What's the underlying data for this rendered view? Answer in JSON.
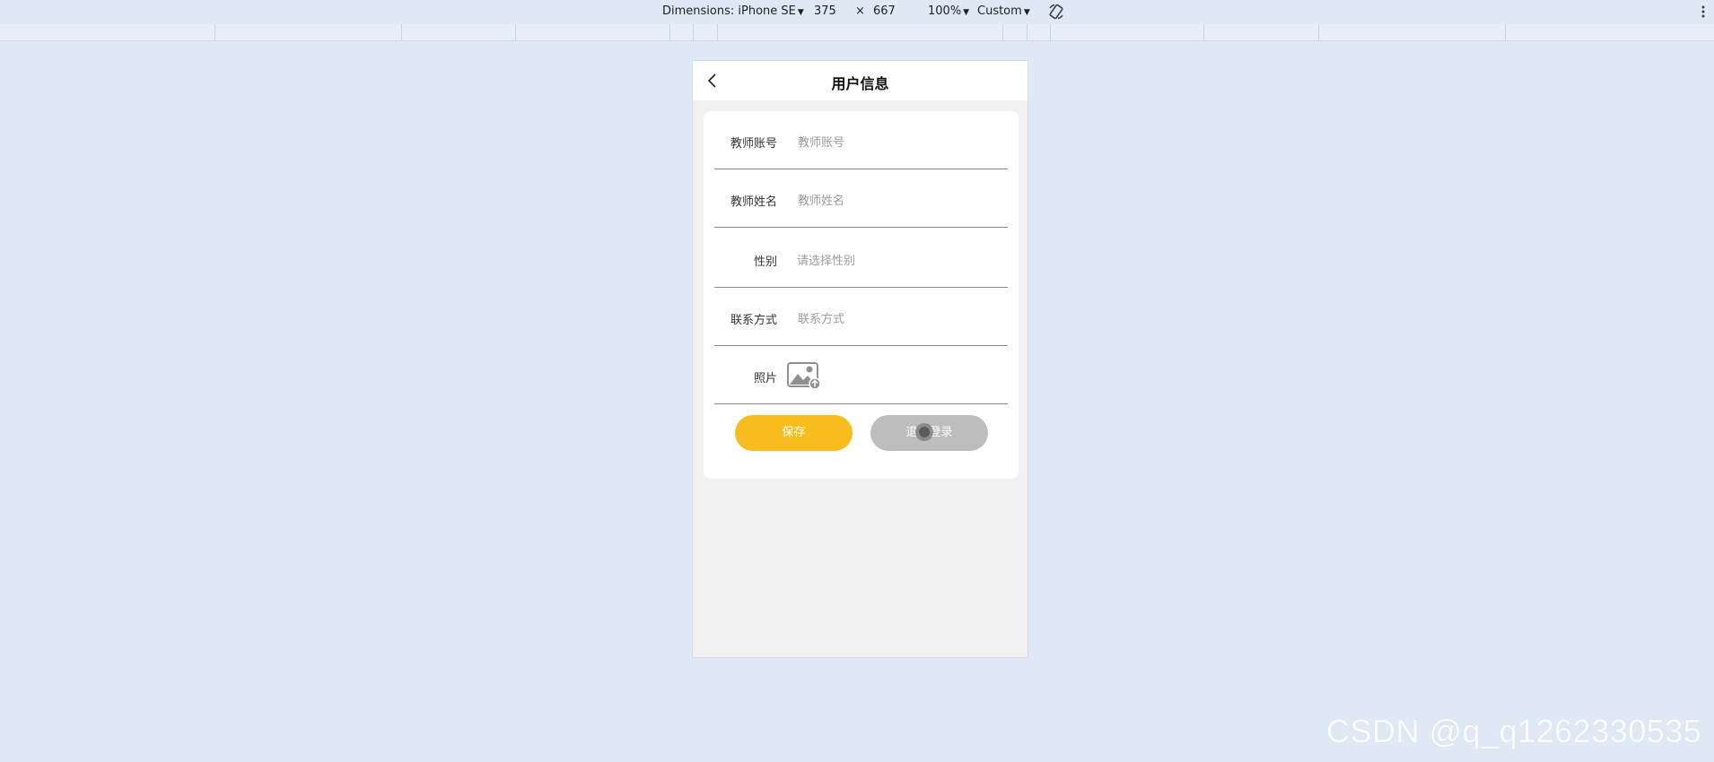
{
  "devtools": {
    "dimensions_label": "Dimensions: iPhone SE",
    "width": "375",
    "times": "×",
    "height": "667",
    "zoom": "100%",
    "throttle": "Custom"
  },
  "screen": {
    "title": "用户信息",
    "fields": [
      {
        "label": "教师账号",
        "placeholder": "教师账号"
      },
      {
        "label": "教师姓名",
        "placeholder": "教师姓名"
      },
      {
        "label": "性别",
        "placeholder": "请选择性别"
      },
      {
        "label": "联系方式",
        "placeholder": "联系方式"
      },
      {
        "label": "照片"
      }
    ],
    "save_label": "保存",
    "logout_label": "退出登录"
  },
  "colors": {
    "save": "#f7bd1e",
    "logout": "#bdbdbd"
  },
  "watermark": "CSDN @q_q1262330535"
}
